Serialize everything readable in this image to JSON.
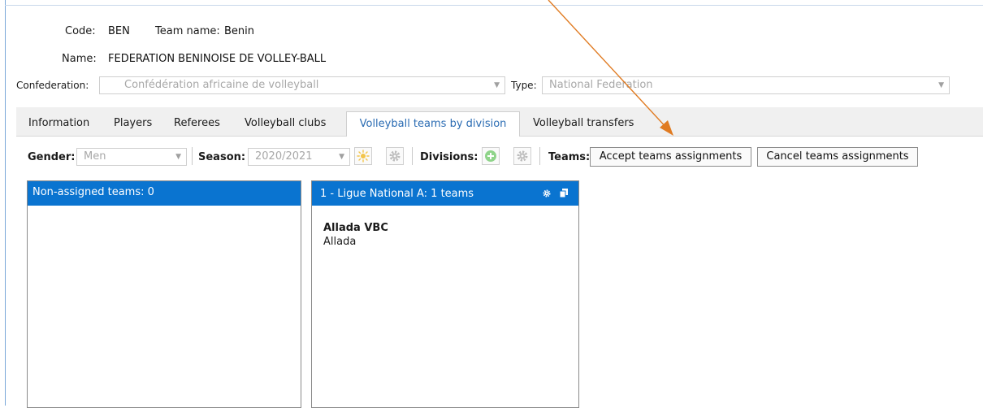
{
  "header": {
    "code_label": "Code:",
    "code_value": "BEN",
    "team_name_label": "Team name:",
    "team_name_value": "Benin",
    "name_label": "Name:",
    "name_value": "FEDERATION BENINOISE DE VOLLEY-BALL",
    "confederation_label": "Confederation:",
    "confederation_value": "Confédération africaine de volleyball",
    "type_label": "Type:",
    "type_value": "National Federation"
  },
  "tabs": [
    {
      "label": "Information"
    },
    {
      "label": "Players"
    },
    {
      "label": "Referees"
    },
    {
      "label": "Volleyball clubs"
    },
    {
      "label": "Volleyball teams by division",
      "active": true
    },
    {
      "label": "Volleyball transfers"
    }
  ],
  "toolbar": {
    "gender_label": "Gender:",
    "gender_value": "Men",
    "season_label": "Season:",
    "season_value": "2020/2021",
    "divisions_label": "Divisions:",
    "teams_label": "Teams:",
    "accept_button": "Accept teams assignments",
    "cancel_button": "Cancel teams assignments"
  },
  "panels": {
    "non_assigned_title": "Non-assigned teams: 0",
    "division_title": "1 - Ligue National A: 1 teams",
    "division_teams": [
      {
        "name": "Allada VBC",
        "city": "Allada"
      }
    ]
  },
  "colors": {
    "accent": "#0a74d0",
    "active_tab_text": "#2b6cb3",
    "annotation_arrow": "#e07b22"
  },
  "icons": {
    "dropdown": "chevron-down-icon",
    "new_season": "sun-icon",
    "settings": "gear-icon",
    "add_division": "plus-circle-icon",
    "division_settings": "gear-icon",
    "division_copy": "copy-icon"
  }
}
